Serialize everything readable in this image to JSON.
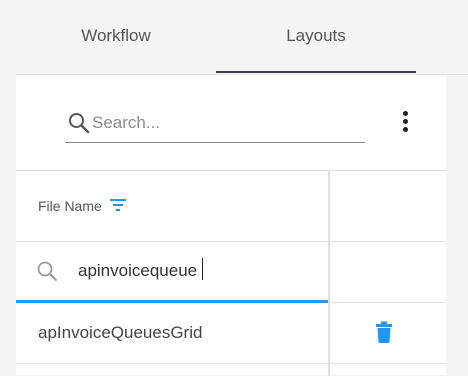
{
  "tabs": [
    {
      "label": "Workflow",
      "active": false
    },
    {
      "label": "Layouts",
      "active": true
    }
  ],
  "search": {
    "value": "",
    "placeholder": "Search..."
  },
  "grid": {
    "columns": [
      {
        "label": "File Name",
        "filter_icon": "filter-icon"
      }
    ],
    "column_filter": {
      "value": "apinvoicequeue",
      "placeholder": ""
    },
    "rows": [
      {
        "file_name": "apInvoiceQueuesGrid",
        "action_icon": "trash-icon"
      }
    ]
  },
  "colors": {
    "accent": "#2196f3",
    "active_tab_indicator": "#3e3e4e",
    "panel_bg": "#ffffff",
    "page_bg": "#f4f4f4"
  }
}
